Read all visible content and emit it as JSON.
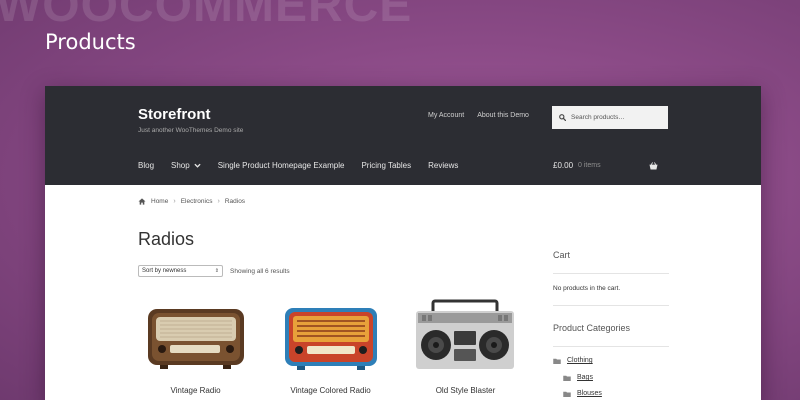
{
  "background": {
    "watermark": "WOOCOMMERCE",
    "hero_title": "Products",
    "color": "#8a4a86"
  },
  "header": {
    "site_title": "Storefront",
    "site_description": "Just another WooThemes Demo site",
    "secondary_nav": [
      "My Account",
      "About this Demo"
    ],
    "search_placeholder": "Search products…",
    "primary_nav": [
      {
        "label": "Blog"
      },
      {
        "label": "Shop",
        "has_dropdown": true
      },
      {
        "label": "Single Product Homepage Example"
      },
      {
        "label": "Pricing Tables"
      },
      {
        "label": "Reviews"
      }
    ],
    "cart_amount": "£0.00",
    "cart_count": "0 items",
    "background_color": "#2c2d33"
  },
  "breadcrumb": [
    "Home",
    "Electronics",
    "Radios"
  ],
  "page_title": "Radios",
  "sorting": {
    "selected": "Sort by newness",
    "result_count": "Showing all 6 results"
  },
  "products": [
    {
      "name": "Vintage Radio",
      "icon": "vintage-radio-image"
    },
    {
      "name": "Vintage Colored Radio",
      "icon": "colored-radio-image"
    },
    {
      "name": "Old Style Blaster",
      "icon": "boombox-image"
    }
  ],
  "sidebar": {
    "cart_title": "Cart",
    "cart_empty": "No products in the cart.",
    "categories_title": "Product Categories",
    "categories": [
      {
        "label": "Clothing",
        "level": 0
      },
      {
        "label": "Bags",
        "level": 1
      },
      {
        "label": "Blouses",
        "level": 1
      }
    ]
  }
}
